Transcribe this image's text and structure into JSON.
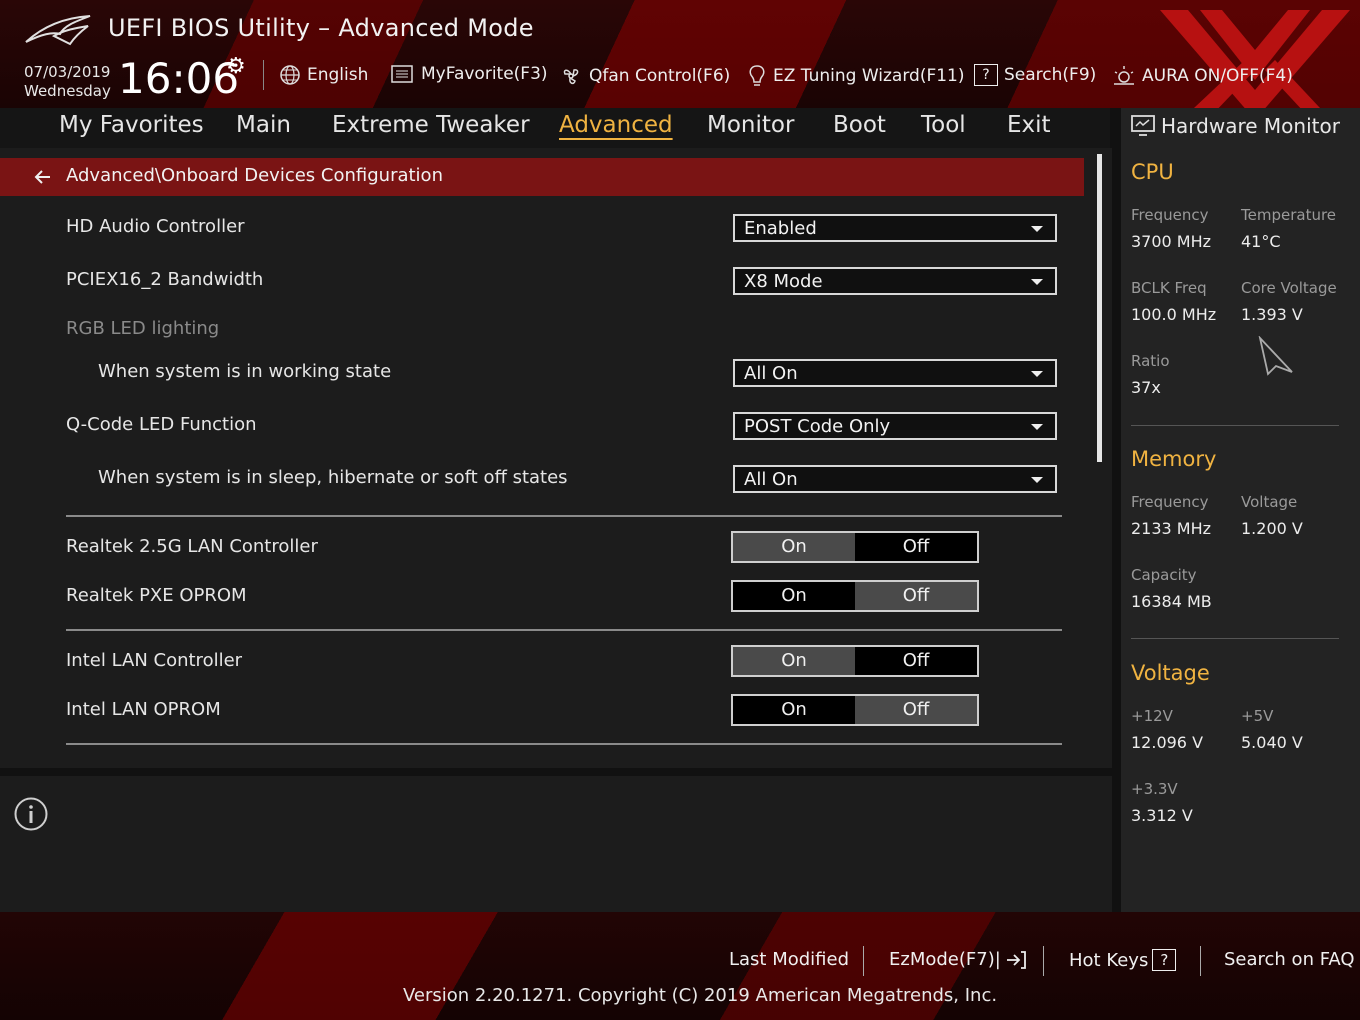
{
  "header": {
    "title": "UEFI BIOS Utility – Advanced Mode",
    "date": "07/03/2019",
    "weekday": "Wednesday",
    "time": "16:06",
    "toolbar": [
      {
        "icon": "globe-icon",
        "label": "English"
      },
      {
        "icon": "favorite-icon",
        "label": "MyFavorite(F3)"
      },
      {
        "icon": "fan-icon",
        "label": "Qfan Control(F6)"
      },
      {
        "icon": "lightbulb-icon",
        "label": "EZ Tuning Wizard(F11)"
      },
      {
        "icon": "search-help-icon",
        "label": "Search(F9)"
      },
      {
        "icon": "aura-icon",
        "label": "AURA ON/OFF(F4)"
      }
    ]
  },
  "nav": {
    "tabs": [
      "My Favorites",
      "Main",
      "Extreme Tweaker",
      "Advanced",
      "Monitor",
      "Boot",
      "Tool",
      "Exit"
    ],
    "active": "Advanced"
  },
  "breadcrumb": "Advanced\\Onboard Devices Configuration",
  "settings": {
    "hd_audio": {
      "label": "HD Audio Controller",
      "value": "Enabled"
    },
    "pciex16": {
      "label": "PCIEX16_2 Bandwidth",
      "value": "X8 Mode"
    },
    "rgb_header": "RGB LED lighting",
    "working_state": {
      "label": "When system is in working state",
      "value": "All On"
    },
    "qcode": {
      "label": "Q-Code LED Function",
      "value": "POST Code Only"
    },
    "sleep_state": {
      "label": "When system is in sleep, hibernate or soft off states",
      "value": "All On"
    },
    "realtek_lan": {
      "label": "Realtek 2.5G LAN Controller",
      "on": "On",
      "off": "Off",
      "selected": "On"
    },
    "realtek_pxe": {
      "label": "Realtek PXE OPROM",
      "on": "On",
      "off": "Off",
      "selected": "Off"
    },
    "intel_lan": {
      "label": "Intel LAN Controller",
      "on": "On",
      "off": "Off",
      "selected": "On"
    },
    "intel_oprom": {
      "label": "Intel LAN OPROM",
      "on": "On",
      "off": "Off",
      "selected": "Off"
    }
  },
  "hw_monitor": {
    "title": "Hardware Monitor",
    "cpu": {
      "heading": "CPU",
      "frequency_label": "Frequency",
      "frequency": "3700 MHz",
      "temperature_label": "Temperature",
      "temperature": "41°C",
      "bclk_label": "BCLK Freq",
      "bclk": "100.0 MHz",
      "core_voltage_label": "Core Voltage",
      "core_voltage": "1.393 V",
      "ratio_label": "Ratio",
      "ratio": "37x"
    },
    "memory": {
      "heading": "Memory",
      "frequency_label": "Frequency",
      "frequency": "2133 MHz",
      "voltage_label": "Voltage",
      "voltage": "1.200 V",
      "capacity_label": "Capacity",
      "capacity": "16384 MB"
    },
    "voltage": {
      "heading": "Voltage",
      "v12_label": "+12V",
      "v12": "12.096 V",
      "v5_label": "+5V",
      "v5": "5.040 V",
      "v33_label": "+3.3V",
      "v33": "3.312 V"
    }
  },
  "footer": {
    "last_modified": "Last Modified",
    "ezmode": "EzMode(F7)|",
    "hot_keys": "Hot Keys",
    "search_faq": "Search on FAQ",
    "version": "Version 2.20.1271. Copyright (C) 2019 American Megatrends, Inc."
  },
  "colors": {
    "accent": "#f0b341",
    "breadcrumb_bg": "#7a1414",
    "panel_bg": "#1c1c1c"
  }
}
